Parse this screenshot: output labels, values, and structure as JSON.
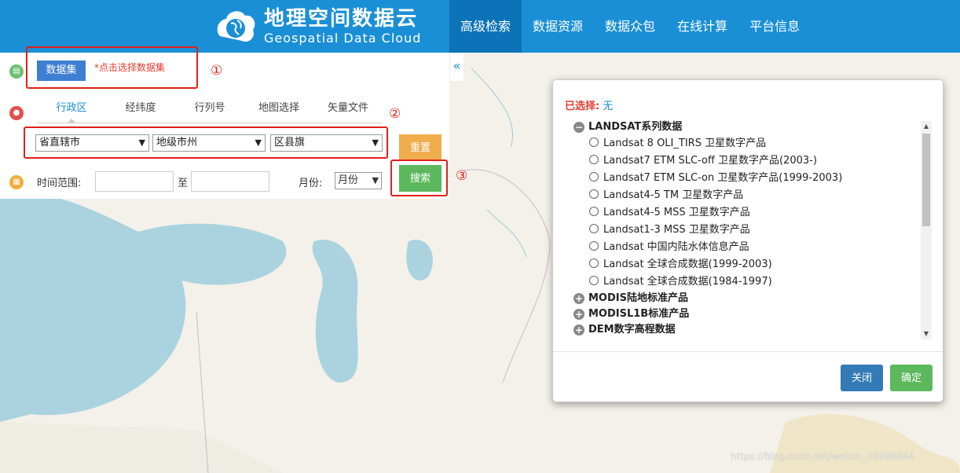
{
  "header": {
    "logo_cn": "地理空间数据云",
    "logo_en": "Geospatial Data Cloud",
    "nav": [
      {
        "label": "高级检索",
        "active": true
      },
      {
        "label": "数据资源",
        "active": false
      },
      {
        "label": "数据众包",
        "active": false
      },
      {
        "label": "在线计算",
        "active": false
      },
      {
        "label": "平台信息",
        "active": false
      }
    ]
  },
  "search_panel": {
    "collapse_icon": "«",
    "dataset_button": "数据集",
    "dataset_hint": "*点击选择数据集",
    "tabs": [
      {
        "label": "行政区",
        "active": true
      },
      {
        "label": "经纬度",
        "active": false
      },
      {
        "label": "行列号",
        "active": false
      },
      {
        "label": "地图选择",
        "active": false
      },
      {
        "label": "矢量文件",
        "active": false
      }
    ],
    "province_select": "省直辖市",
    "city_select": "地级市州",
    "county_select": "区县旗",
    "reset_button": "重置",
    "search_button": "搜索",
    "time_label": "时间范围:",
    "time_to": "至",
    "month_label": "月份:",
    "month_select": "月份"
  },
  "annotations": [
    "①",
    "②",
    "③"
  ],
  "modal": {
    "selected_label": "已选择:",
    "selected_value": "无",
    "tree": [
      {
        "type": "group",
        "expanded": true,
        "label": "LANDSAT系列数据"
      },
      {
        "type": "leaf",
        "label": "Landsat 8 OLI_TIRS 卫星数字产品"
      },
      {
        "type": "leaf",
        "label": "Landsat7 ETM SLC-off 卫星数字产品(2003-)"
      },
      {
        "type": "leaf",
        "label": "Landsat7 ETM SLC-on 卫星数字产品(1999-2003)"
      },
      {
        "type": "leaf",
        "label": "Landsat4-5 TM 卫星数字产品"
      },
      {
        "type": "leaf",
        "label": "Landsat4-5 MSS 卫星数字产品"
      },
      {
        "type": "leaf",
        "label": "Landsat1-3 MSS 卫星数字产品"
      },
      {
        "type": "leaf",
        "label": "Landsat 中国内陆水体信息产品"
      },
      {
        "type": "leaf",
        "label": "Landsat 全球合成数据(1999-2003)"
      },
      {
        "type": "leaf",
        "label": "Landsat 全球合成数据(1984-1997)"
      },
      {
        "type": "group",
        "expanded": false,
        "label": "MODIS陆地标准产品"
      },
      {
        "type": "group",
        "expanded": false,
        "label": "MODISL1B标准产品"
      },
      {
        "type": "group",
        "expanded": false,
        "label": "DEM数字高程数据"
      }
    ],
    "close_button": "关闭",
    "confirm_button": "确定"
  },
  "watermark": "https://blog.csdn.net/weixin_39498844",
  "colors": {
    "header_bg": "#1a8fd6",
    "nav_active": "#0c73b8",
    "dataset_button": "#3e7fd3",
    "reset_button": "#f0ad4e",
    "search_button": "#5cb85c",
    "annotation": "#e0201b",
    "close_button": "#337ab7",
    "confirm_button": "#5cb85c",
    "water": "#aad3df"
  },
  "icons": [
    "logo-globe-icon",
    "document-icon",
    "map-pin-icon",
    "calendar-icon",
    "collapse-left-icon",
    "minus-circle-icon",
    "plus-circle-icon",
    "radio-icon"
  ]
}
